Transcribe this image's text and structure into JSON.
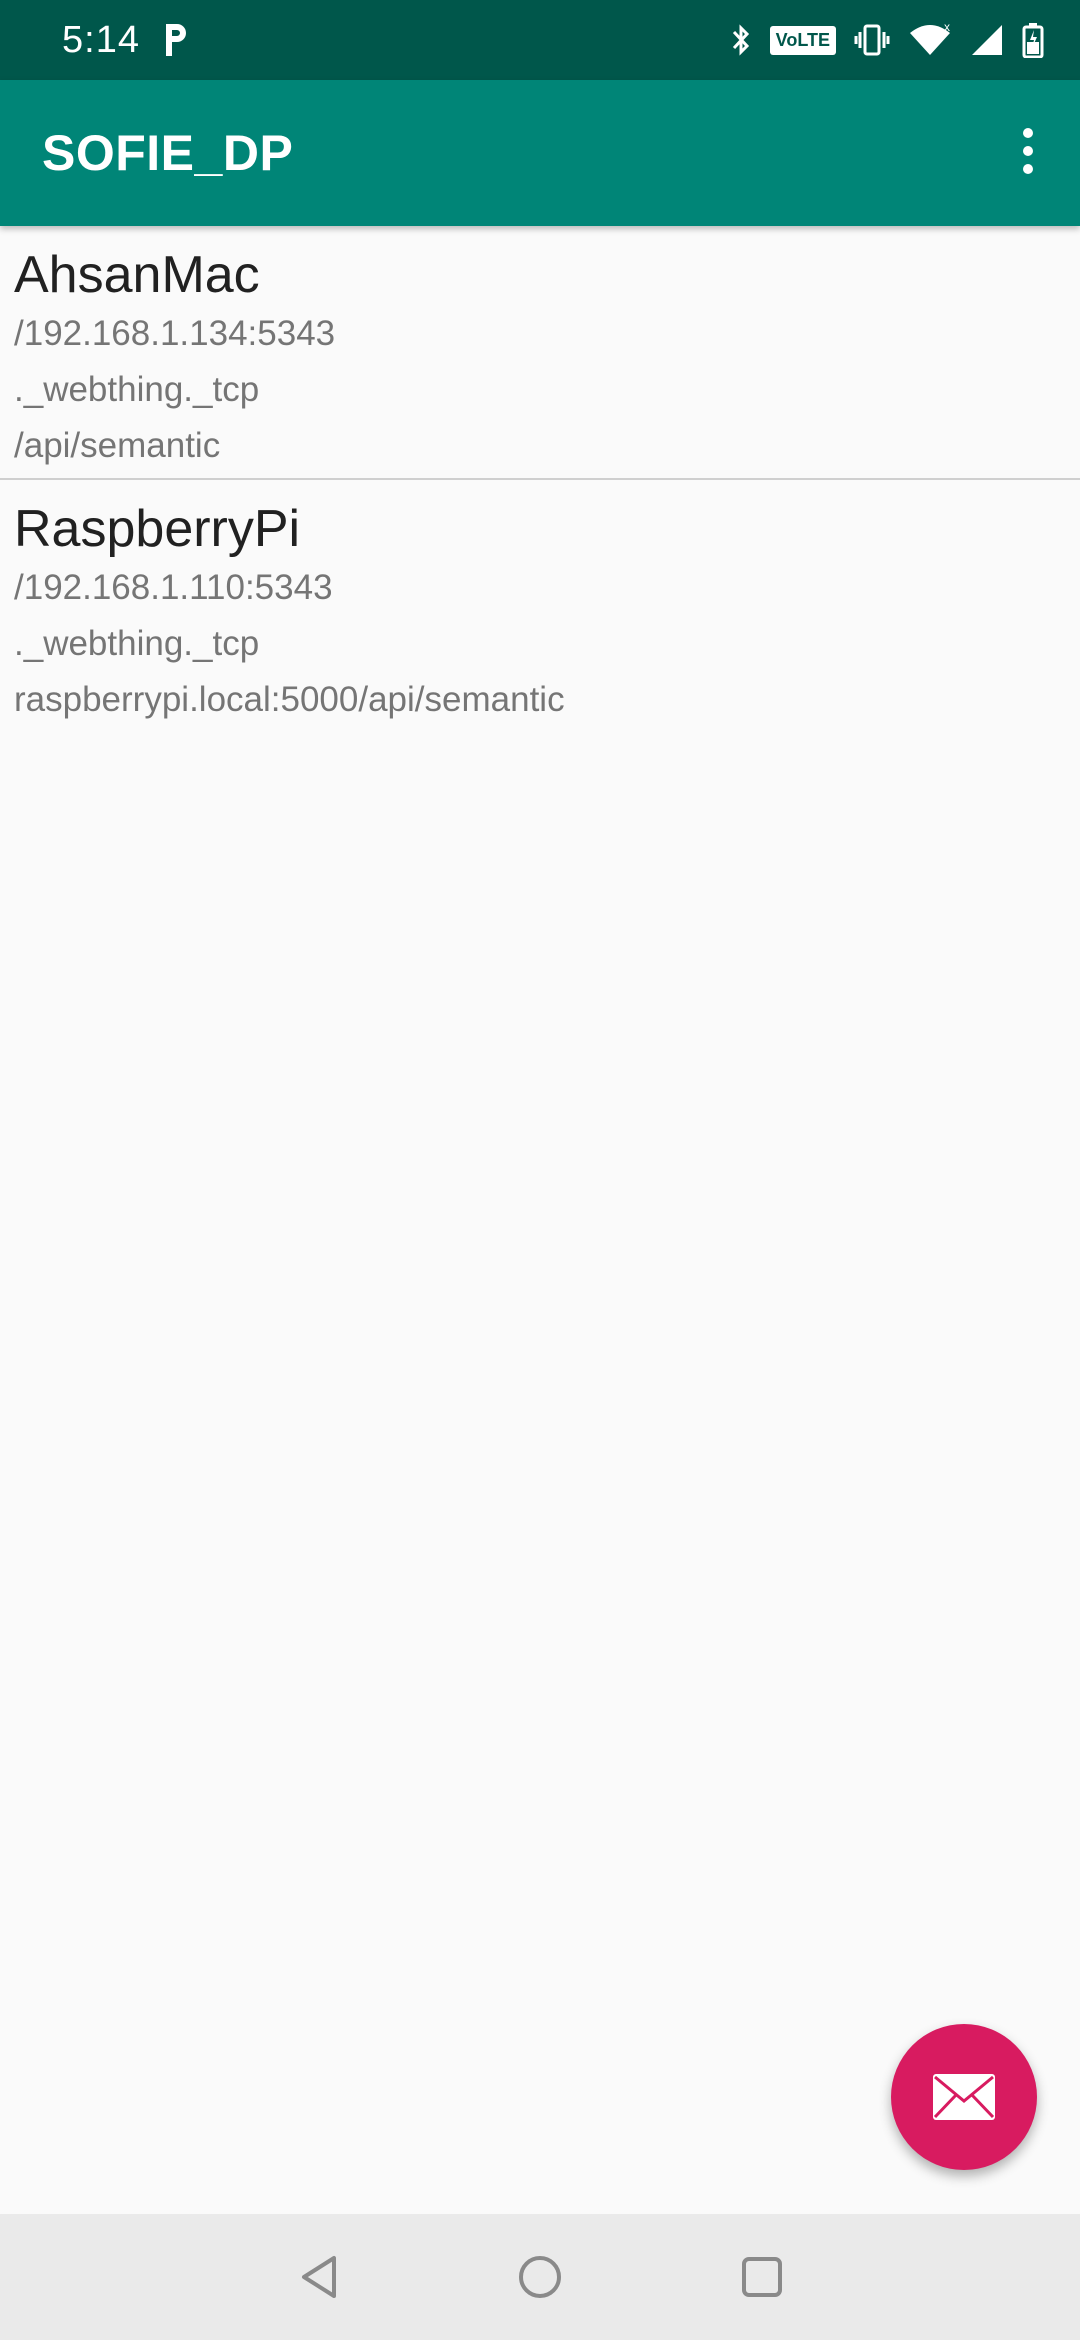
{
  "status_bar": {
    "time": "5:14",
    "icons": [
      "parking-icon",
      "bluetooth-icon",
      "volte-icon",
      "vibrate-icon",
      "wifi-icon",
      "signal-icon",
      "battery-icon"
    ],
    "volte_label": "VoLTE"
  },
  "app_bar": {
    "title": "SOFIE_DP",
    "menu_icon": "overflow-menu-icon"
  },
  "devices": [
    {
      "name": "AhsanMac",
      "address": "/192.168.1.134:5343",
      "service": "._webthing._tcp",
      "path": "/api/semantic"
    },
    {
      "name": "RaspberryPi",
      "address": "/192.168.1.110:5343",
      "service": "._webthing._tcp",
      "path": "raspberrypi.local:5000/api/semantic"
    }
  ],
  "fab": {
    "icon": "email-icon"
  },
  "nav_bar": {
    "buttons": [
      "back-icon",
      "home-icon",
      "recents-icon"
    ]
  },
  "colors": {
    "status_bar": "#00574b",
    "app_bar": "#008577",
    "fab": "#d81b60",
    "background": "#fafafa"
  }
}
